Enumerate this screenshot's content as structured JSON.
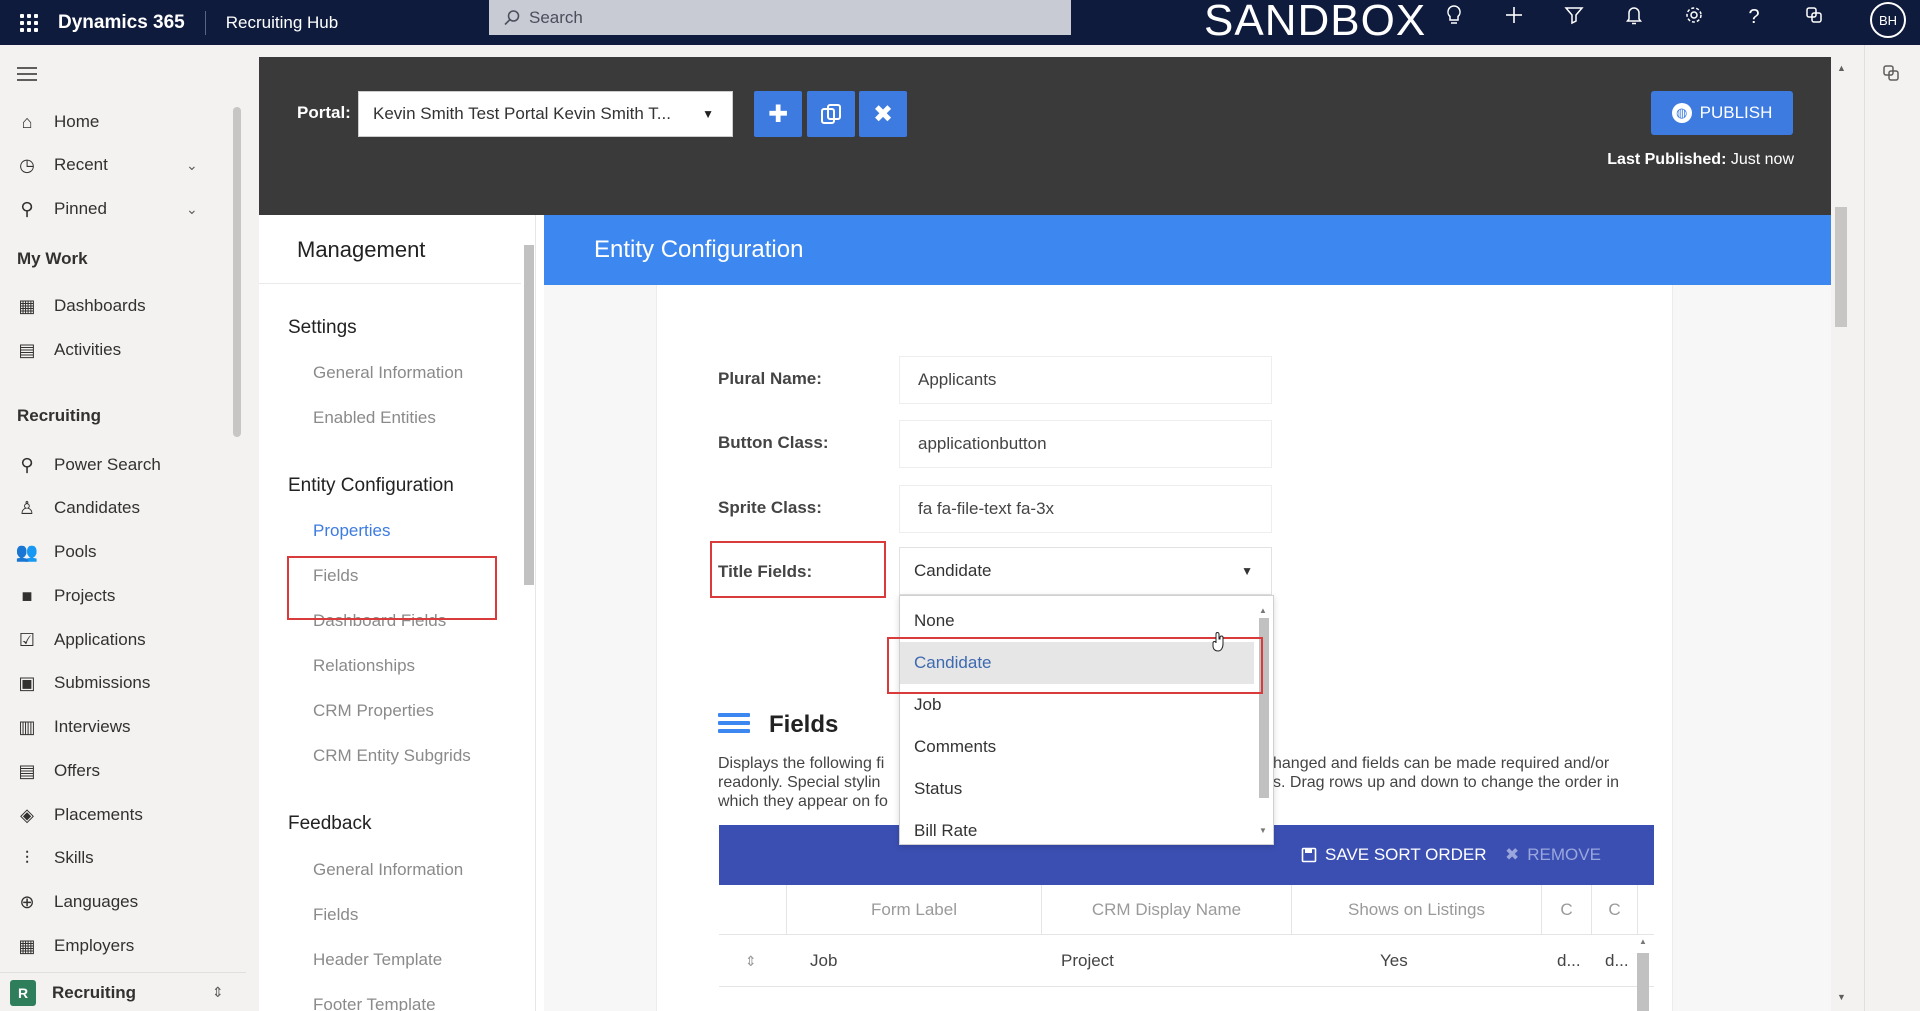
{
  "topbar": {
    "brand": "Dynamics 365",
    "app_name": "Recruiting Hub",
    "search_placeholder": "Search",
    "environment": "SANDBOX",
    "user_initials": "BH"
  },
  "nav": {
    "items": [
      {
        "label": "Home",
        "icon": "home-icon"
      },
      {
        "label": "Recent",
        "icon": "clock-icon"
      },
      {
        "label": "Pinned",
        "icon": "pin-icon"
      }
    ],
    "my_work_header": "My Work",
    "my_work": [
      {
        "label": "Dashboards"
      },
      {
        "label": "Activities"
      }
    ],
    "recruiting_header": "Recruiting",
    "recruiting": [
      {
        "label": "Power Search"
      },
      {
        "label": "Candidates"
      },
      {
        "label": "Pools"
      },
      {
        "label": "Projects"
      },
      {
        "label": "Applications"
      },
      {
        "label": "Submissions"
      },
      {
        "label": "Interviews"
      },
      {
        "label": "Offers"
      },
      {
        "label": "Placements"
      },
      {
        "label": "Skills"
      },
      {
        "label": "Languages"
      },
      {
        "label": "Employers"
      }
    ],
    "area_letter": "R",
    "area_label": "Recruiting"
  },
  "toolbar": {
    "portal_label": "Portal:",
    "portal_value": "Kevin Smith Test Portal Kevin Smith T...",
    "publish_label": "PUBLISH",
    "last_published_label": "Last Published:",
    "last_published_value": "Just now"
  },
  "management": {
    "title": "Management",
    "settings_header": "Settings",
    "settings_items": [
      "General Information",
      "Enabled Entities"
    ],
    "entity_header": "Entity Configuration",
    "entity_items": [
      "Properties",
      "Fields",
      "Dashboard Fields",
      "Relationships",
      "CRM Properties",
      "CRM Entity Subgrids"
    ],
    "feedback_header": "Feedback",
    "feedback_items": [
      "General Information",
      "Fields",
      "Header Template",
      "Footer Template"
    ]
  },
  "entity": {
    "banner": "Entity Configuration",
    "plural_name_label": "Plural Name:",
    "plural_name_value": "Applicants",
    "button_class_label": "Button Class:",
    "button_class_value": "applicationbutton",
    "sprite_class_label": "Sprite Class:",
    "sprite_class_value": "fa fa-file-text fa-3x",
    "title_fields_label": "Title Fields:",
    "title_fields_value": "Candidate",
    "title_fields_options": [
      "None",
      "Candidate",
      "Job",
      "Comments",
      "Status",
      "Bill Rate"
    ]
  },
  "fields_section": {
    "title": "Fields",
    "desc_line1_left": "Displays the following fi",
    "desc_line1_right": "hanged and fields can be made required and/or",
    "desc_line2_left": "readonly. Special stylin",
    "desc_line2_right": "s. Drag rows up and down to change the order in",
    "desc_line3_left": "which they appear on fo",
    "save_sort_label": "SAVE SORT ORDER",
    "remove_label": "REMOVE",
    "columns": [
      "Form Label",
      "CRM Display Name",
      "Shows on Listings",
      "C",
      "C"
    ],
    "rows": [
      {
        "form_label": "Job",
        "crm_display_name": "Project",
        "shows_on_listings": "Yes",
        "c1": "d...",
        "c2": "d..."
      }
    ]
  }
}
